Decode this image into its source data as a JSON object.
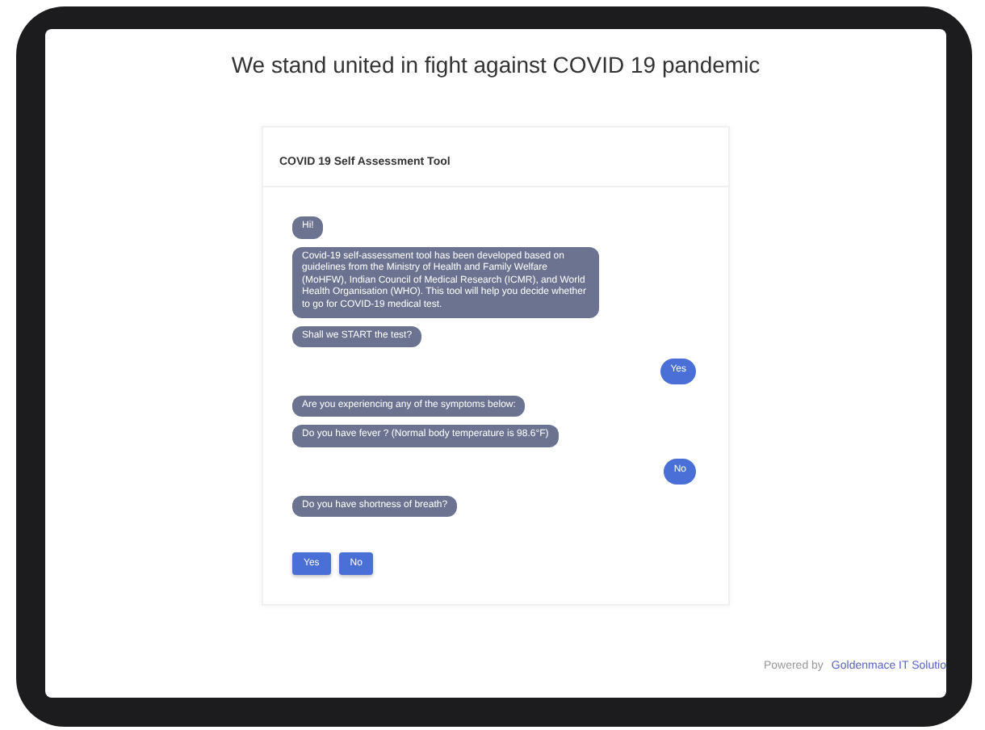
{
  "page": {
    "heading": "We stand united in fight against COVID 19 pandemic"
  },
  "chat": {
    "title": "COVID 19 Self Assessment Tool",
    "messages": [
      {
        "kind": "bot",
        "text": "Hi!"
      },
      {
        "kind": "bot",
        "text": "Covid-19 self-assessment tool has been developed based on guidelines from the Ministry of Health and Family Welfare (MoHFW), Indian Council of Medical Research (ICMR), and World Health Organisation (WHO). This tool will help you decide whether to go for COVID-19 medical test."
      },
      {
        "kind": "bot",
        "text": "Shall we START the test?"
      },
      {
        "kind": "user",
        "text": "Yes"
      },
      {
        "kind": "bot",
        "text": "Are you experiencing any of the symptoms below:"
      },
      {
        "kind": "bot",
        "text": "Do you have fever ? (Normal body temperature is 98.6°F)"
      },
      {
        "kind": "user",
        "text": "No"
      },
      {
        "kind": "bot",
        "text": "Do you have shortness of breath?"
      }
    ],
    "options": [
      "Yes",
      "No"
    ]
  },
  "footer": {
    "label": "Powered by",
    "link": "Goldenmace IT Solutio"
  }
}
